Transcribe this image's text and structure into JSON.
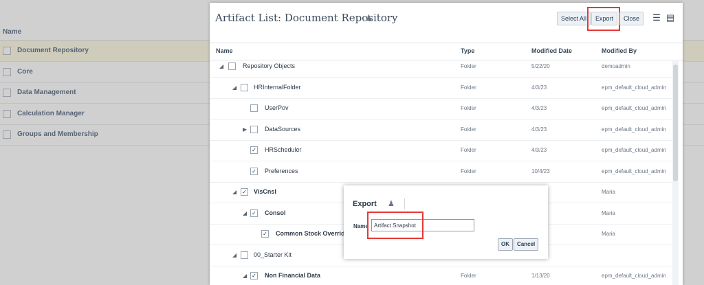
{
  "background_list": {
    "header": "Name",
    "items": [
      {
        "label": "Document Repository",
        "selected": true
      },
      {
        "label": "Core",
        "selected": false
      },
      {
        "label": "Data Management",
        "selected": false
      },
      {
        "label": "Calculation Manager",
        "selected": false
      },
      {
        "label": "Groups and Membership",
        "selected": false
      }
    ]
  },
  "panel": {
    "title": "Artifact List: Document Repository",
    "toolbar": {
      "select_all": "Select All",
      "export": "Export",
      "close": "Close"
    },
    "columns": {
      "name": "Name",
      "type": "Type",
      "modified_date": "Modified Date",
      "modified_by": "Modified By"
    },
    "rows": [
      {
        "name": "Repository Objects",
        "type": "Folder",
        "date": "5/22/20",
        "by": "demoadmin",
        "checked": false,
        "expanded": "open",
        "bold": false
      },
      {
        "name": "HRInternalFolder",
        "type": "Folder",
        "date": "4/3/23",
        "by": "epm_default_cloud_admin",
        "checked": false,
        "expanded": "open",
        "bold": false
      },
      {
        "name": "UserPov",
        "type": "Folder",
        "date": "4/3/23",
        "by": "epm_default_cloud_admin",
        "checked": false,
        "expanded": "none",
        "bold": false
      },
      {
        "name": "DataSources",
        "type": "Folder",
        "date": "4/3/23",
        "by": "epm_default_cloud_admin",
        "checked": false,
        "expanded": "closed",
        "bold": false
      },
      {
        "name": "HRScheduler",
        "type": "Folder",
        "date": "4/3/23",
        "by": "epm_default_cloud_admin",
        "checked": true,
        "expanded": "none",
        "bold": false
      },
      {
        "name": "Preferences",
        "type": "Folder",
        "date": "10/4/23",
        "by": "epm_default_cloud_admin",
        "checked": true,
        "expanded": "none",
        "bold": false
      },
      {
        "name": "VisCnsl",
        "type": "",
        "date": "",
        "by": "Maria",
        "checked": true,
        "expanded": "open",
        "bold": true
      },
      {
        "name": "Consol",
        "type": "",
        "date": "",
        "by": "Maria",
        "checked": true,
        "expanded": "open",
        "bold": true
      },
      {
        "name": "Common Stock Override",
        "type": "",
        "date": "",
        "by": "Maria",
        "checked": true,
        "expanded": "none",
        "bold": true
      },
      {
        "name": "00_Starter Kit",
        "type": "",
        "date": "",
        "by": "",
        "checked": false,
        "expanded": "open",
        "bold": false
      },
      {
        "name": "Non Financial Data",
        "type": "Folder",
        "date": "1/13/20",
        "by": "epm_default_cloud_admin",
        "checked": true,
        "expanded": "open",
        "bold": true
      }
    ]
  },
  "export_dialog": {
    "title": "Export",
    "name_label": "Name",
    "name_value": "Artifact Snapshot",
    "ok": "OK",
    "cancel": "Cancel"
  }
}
